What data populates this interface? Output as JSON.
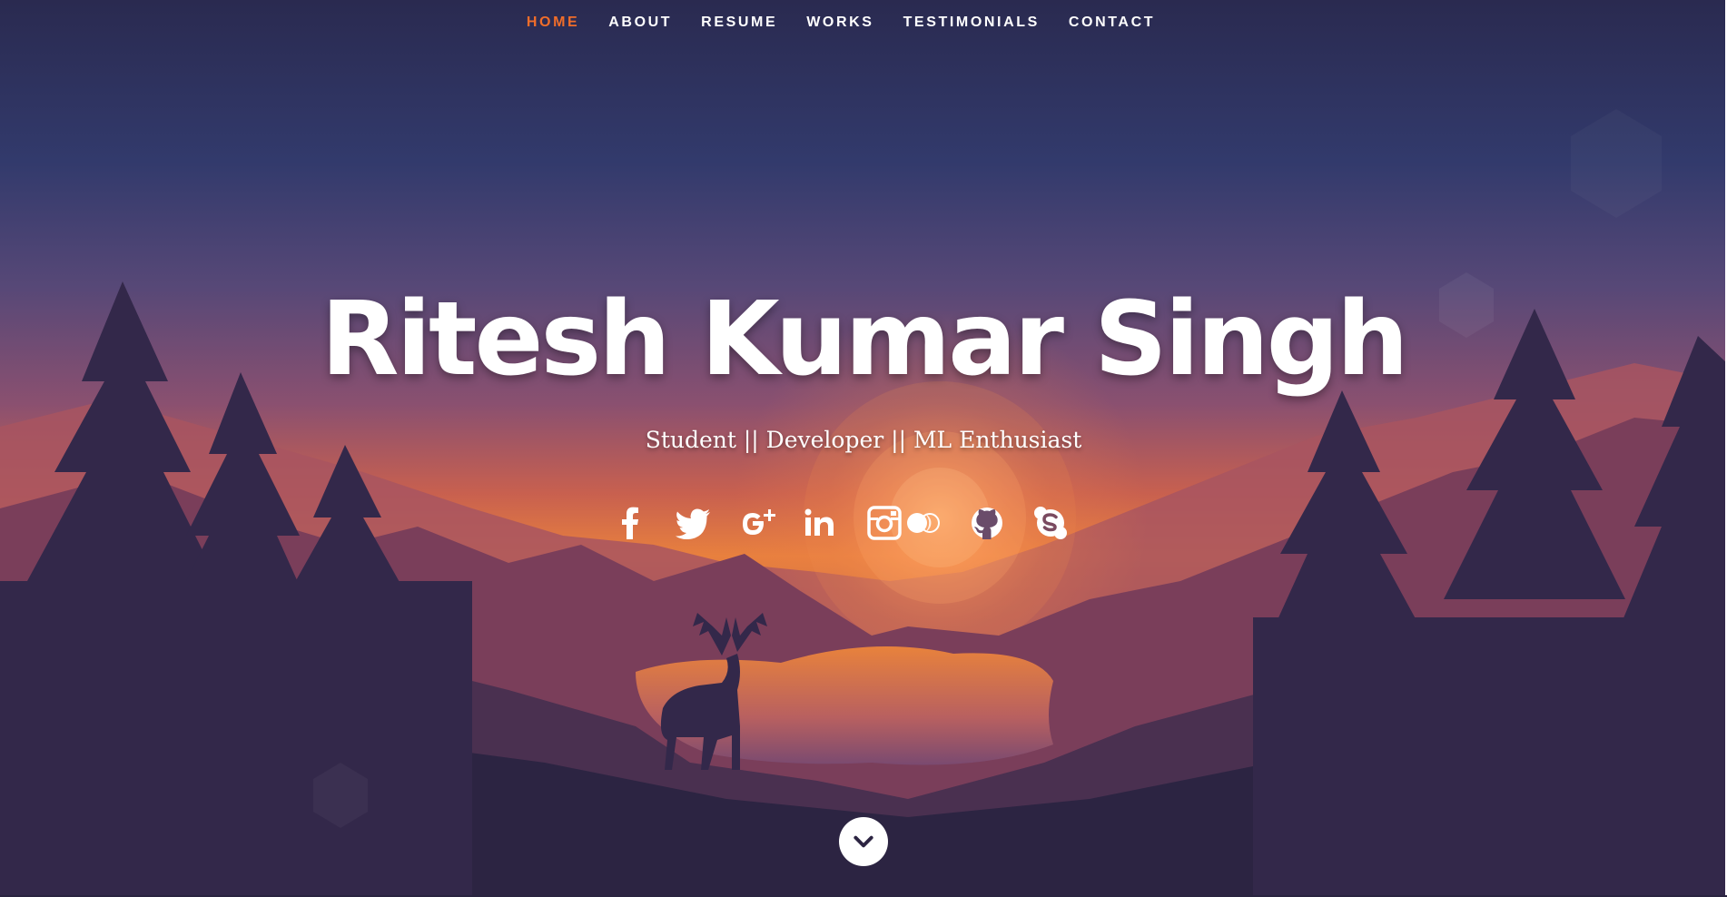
{
  "nav": {
    "items": [
      {
        "label": "HOME",
        "active": true
      },
      {
        "label": "ABOUT",
        "active": false
      },
      {
        "label": "RESUME",
        "active": false
      },
      {
        "label": "WORKS",
        "active": false
      },
      {
        "label": "TESTIMONIALS",
        "active": false
      },
      {
        "label": "CONTACT",
        "active": false
      }
    ],
    "active_color": "#f06d2a"
  },
  "banner": {
    "name": "Ritesh Kumar Singh",
    "tagline": "Student || Developer || ML Enthusiast"
  },
  "social": {
    "icons": [
      "facebook-icon",
      "twitter-icon",
      "google-plus-icon",
      "linkedin-icon",
      "instagram-icon",
      "flickr-icon",
      "github-icon",
      "skype-icon"
    ]
  },
  "scroll": {
    "icon": "chevron-down-icon"
  },
  "colors": {
    "sky_top": "#2d2d55",
    "sky_mid": "#5b4777",
    "horizon": "#f0853a",
    "silhouette": "#2c2442"
  }
}
